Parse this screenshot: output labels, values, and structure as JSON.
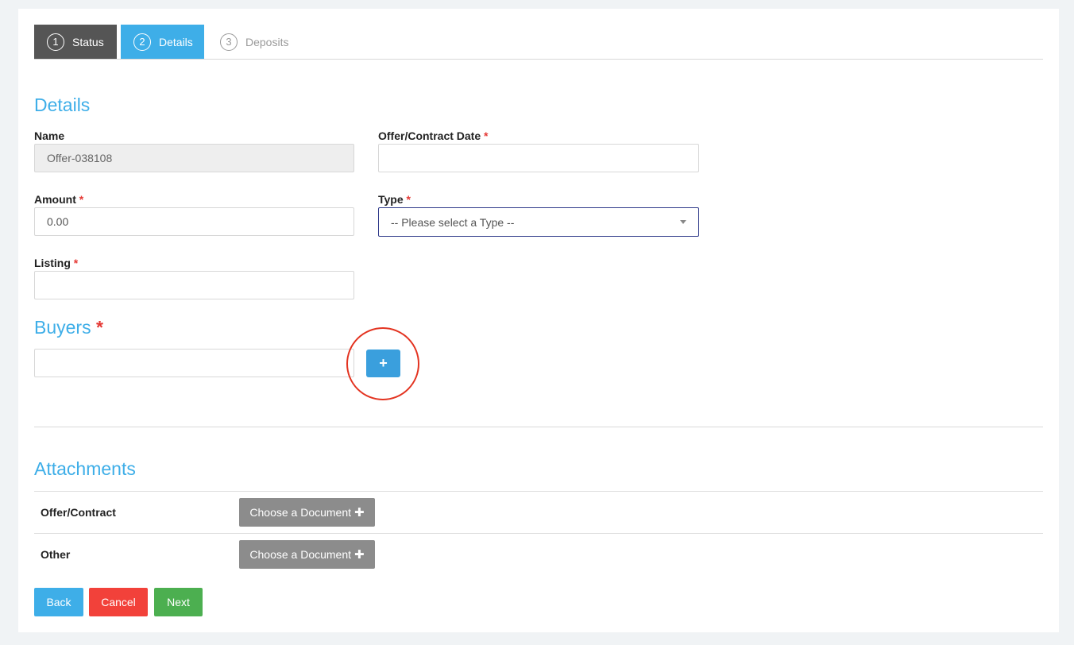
{
  "steps": [
    {
      "num": "1",
      "label": "Status"
    },
    {
      "num": "2",
      "label": "Details"
    },
    {
      "num": "3",
      "label": "Deposits"
    }
  ],
  "details": {
    "title": "Details",
    "name_label": "Name",
    "name_value": "Offer-038108",
    "date_label": "Offer/Contract Date",
    "date_value": "",
    "amount_label": "Amount",
    "amount_value": "0.00",
    "type_label": "Type",
    "type_value": "-- Please select a Type --",
    "listing_label": "Listing",
    "listing_value": "",
    "required_mark": "*"
  },
  "buyers": {
    "title": "Buyers",
    "required_mark": "*",
    "input_value": "",
    "add_label": "+"
  },
  "attachments": {
    "title": "Attachments",
    "rows": [
      {
        "label": "Offer/Contract",
        "button": "Choose a Document",
        "icon": "plus-icon"
      },
      {
        "label": "Other",
        "button": "Choose a Document",
        "icon": "plus-icon"
      }
    ]
  },
  "actions": {
    "back": "Back",
    "cancel": "Cancel",
    "next": "Next"
  },
  "colors": {
    "accent": "#3eaee8",
    "step_status_bg": "#555555",
    "required": "#e53935",
    "cancel": "#f2413a",
    "next": "#4caf50",
    "doc_button": "#8c8c8c",
    "highlight": "#e33320"
  }
}
